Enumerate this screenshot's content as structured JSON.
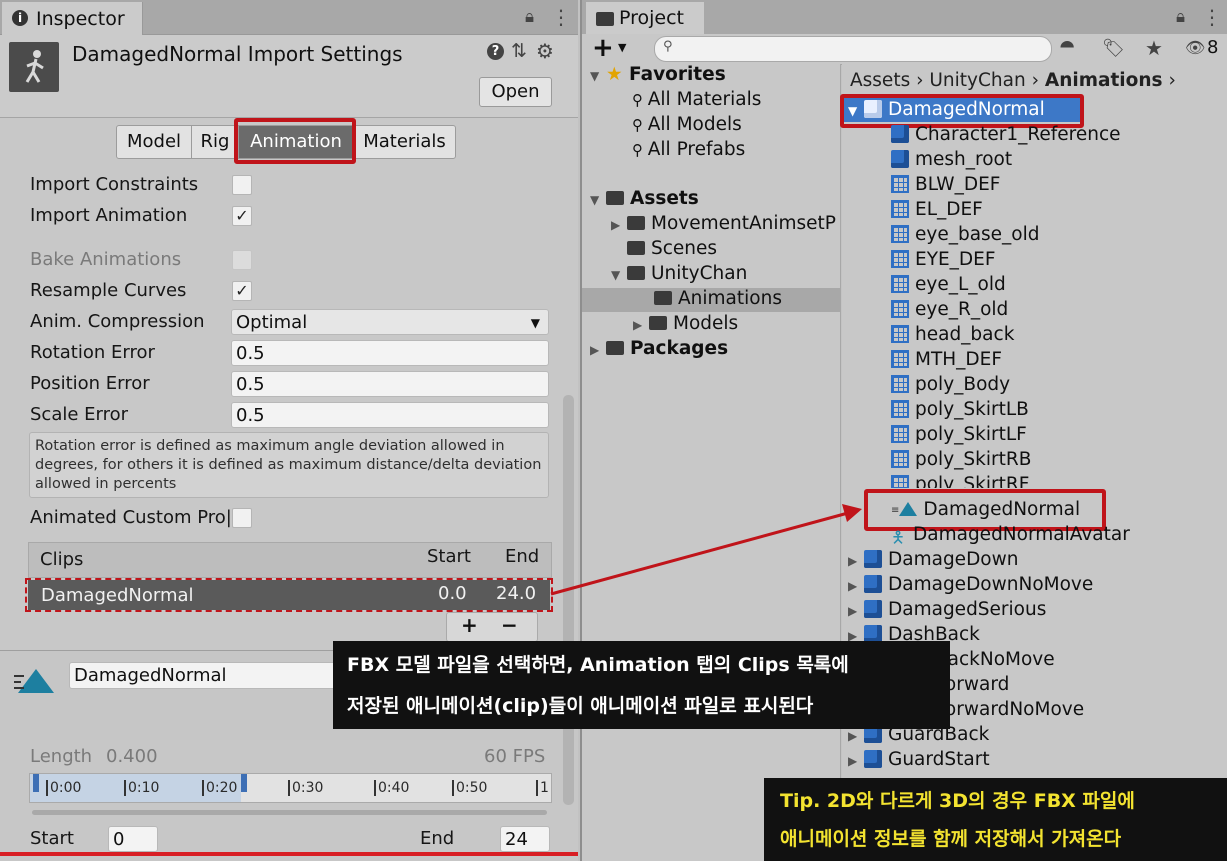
{
  "inspector": {
    "tab_title": "Inspector",
    "import_title": "DamagedNormal Import Settings",
    "open_label": "Open",
    "tabs": [
      "Model",
      "Rig",
      "Animation",
      "Materials"
    ],
    "selected_tab": "Animation",
    "import_constraints": "Import Constraints",
    "import_animation": "Import Animation",
    "bake_animations": "Bake Animations",
    "resample_curves": "Resample Curves",
    "anim_compression_label": "Anim. Compression",
    "anim_compression_value": "Optimal",
    "rotation_error_label": "Rotation Error",
    "rotation_error_value": "0.5",
    "position_error_label": "Position Error",
    "position_error_value": "0.5",
    "scale_error_label": "Scale Error",
    "scale_error_value": "0.5",
    "help_text": "Rotation error is defined as maximum angle deviation allowed in degrees, for others it is defined as maximum distance/delta deviation allowed in percents",
    "animated_custom_props": "Animated Custom Pro|",
    "clips_header": "Clips",
    "start_header": "Start",
    "end_header": "End",
    "clip_name": "DamagedNormal",
    "clip_start": "0.0",
    "clip_end": "24.0",
    "plus": "+",
    "minus": "−",
    "clip_name_field": "DamagedNormal",
    "length_label": "Length",
    "length_value": "0.400",
    "fps_value": "60 FPS",
    "timeline_labels": [
      "0:00",
      "0:10",
      "0:20",
      "0:30",
      "0:40",
      "0:50",
      "1"
    ],
    "start_label": "Start",
    "start_value": "0",
    "end_label": "End",
    "end_value": "24"
  },
  "project": {
    "tab_title": "Project",
    "plus": "+",
    "hidden_count": "8",
    "favorites": "Favorites",
    "fav_items": [
      "All Materials",
      "All Models",
      "All Prefabs"
    ],
    "assets": "Assets",
    "asset_folders": [
      "MovementAnimsetP",
      "Scenes",
      "UnityChan",
      "Animations",
      "Models"
    ],
    "packages": "Packages",
    "breadcrumb": [
      "Assets",
      "UnityChan",
      "Animations"
    ],
    "selected_asset": "DamagedNormal",
    "children_cubes": [
      "Character1_Reference",
      "mesh_root"
    ],
    "children_meshes": [
      "BLW_DEF",
      "EL_DEF",
      "eye_base_old",
      "EYE_DEF",
      "eye_L_old",
      "eye_R_old",
      "head_back",
      "MTH_DEF",
      "poly_Body",
      "poly_SkirtLB",
      "poly_SkirtLF",
      "poly_SkirtRB",
      "poly_SkirtRF"
    ],
    "clip_asset": "DamagedNormal",
    "avatar_asset": "DamagedNormalAvatar",
    "other_assets": [
      "DamageDown",
      "DamageDownNoMove",
      "DamagedSerious",
      "DashBack",
      "DashBackNoMove",
      "DashForward",
      "DashForwardNoMove",
      "GuardBack",
      "GuardStart"
    ]
  },
  "captions": {
    "line1": "FBX 모델 파일을 선택하면, Animation 탭의 Clips 목록에",
    "line2": "저장된 애니메이션(clip)들이 애니메이션 파일로 표시된다",
    "tip1": "Tip. 2D와 다르게 3D의 경우 FBX 파일에",
    "tip2": "애니메이션 정보를 함께 저장해서 가져온다"
  },
  "colors": {
    "highlight_red": "#c0141a",
    "selection_blue": "#3d78c7",
    "caption_bg": "#111111",
    "tip_text": "#f3e330"
  }
}
